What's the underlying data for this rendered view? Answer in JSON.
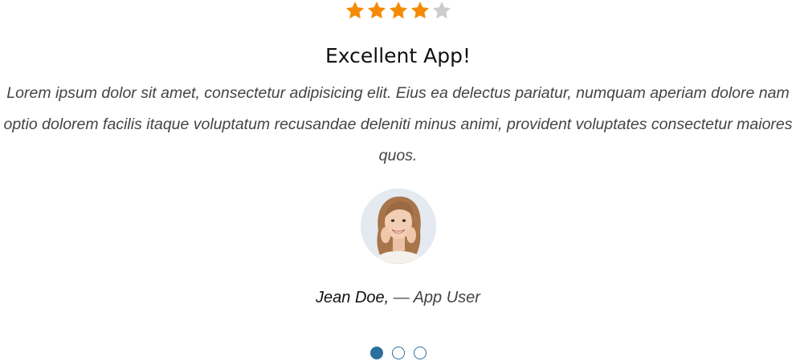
{
  "rating": {
    "value": 4,
    "max": 5,
    "filled_color": "#f58a07",
    "empty_color": "#cccccc",
    "icon": "star-icon"
  },
  "testimonial": {
    "title": "Excellent App!",
    "quote": "Lorem ipsum dolor sit amet, consectetur adipisicing elit. Eius ea delectus pariatur, numquam aperiam dolore nam optio dolorem facilis itaque voluptatum recusandae deleniti minus animi, provident voluptates consectetur maiores quos.",
    "author_name": "Jean Doe,",
    "author_separator": "—",
    "author_role": "App User"
  },
  "carousel": {
    "slide_count": 3,
    "active_index": 0,
    "accent_color": "#2b6f9c"
  }
}
